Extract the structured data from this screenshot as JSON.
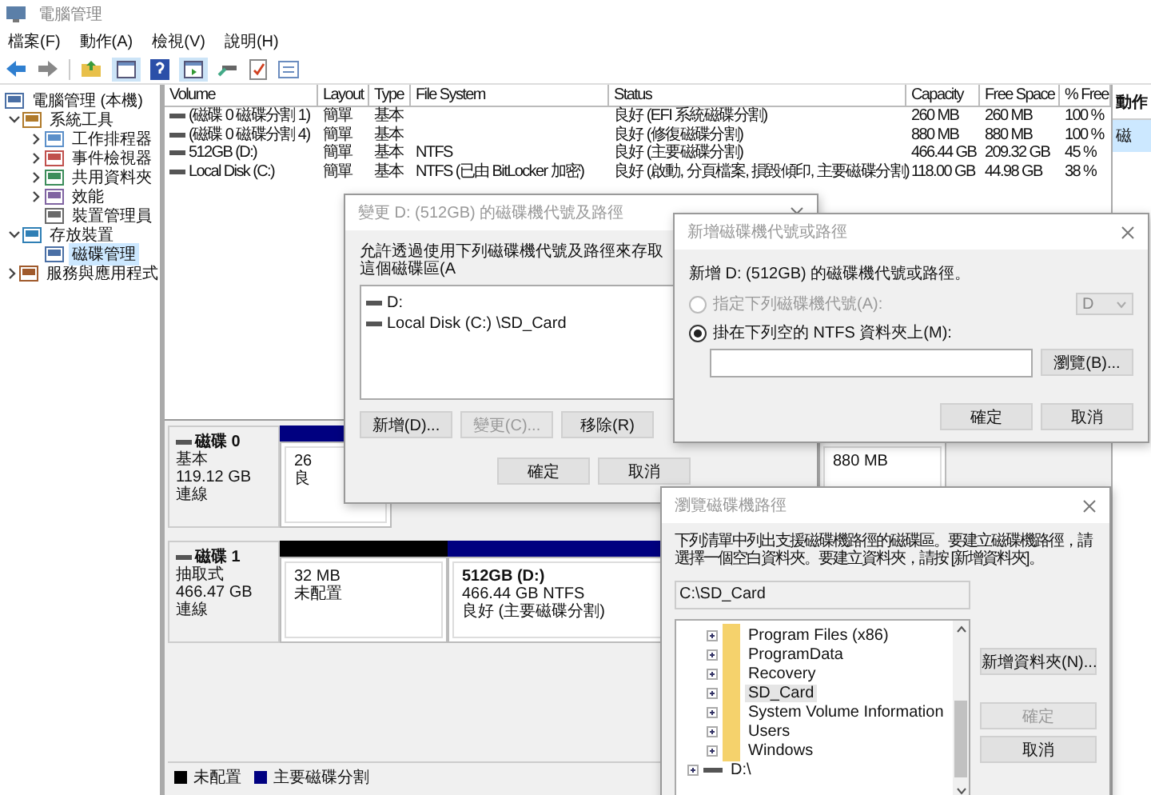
{
  "window": {
    "title": "電腦管理"
  },
  "menu": [
    "檔案(F)",
    "動作(A)",
    "檢視(V)",
    "說明(H)"
  ],
  "tree": [
    {
      "label": "電腦管理 (本機)",
      "kind": "root",
      "selected": false,
      "children": [
        {
          "label": "系統工具",
          "kind": "node",
          "expanded": true,
          "selected": false,
          "children": [
            {
              "label": "工作排程器",
              "kind": "node",
              "expanded": false,
              "selected": false
            },
            {
              "label": "事件檢視器",
              "kind": "node",
              "expanded": false,
              "selected": false
            },
            {
              "label": "共用資料夾",
              "kind": "node",
              "expanded": false,
              "selected": false
            },
            {
              "label": "效能",
              "kind": "node",
              "expanded": false,
              "selected": false
            },
            {
              "label": "裝置管理員",
              "kind": "leaf",
              "selected": false
            }
          ]
        },
        {
          "label": "存放裝置",
          "kind": "node",
          "expanded": true,
          "selected": false,
          "children": [
            {
              "label": "磁碟管理",
              "kind": "leaf",
              "selected": true
            }
          ]
        },
        {
          "label": "服務與應用程式",
          "kind": "node",
          "expanded": false,
          "selected": false
        }
      ]
    }
  ],
  "table": {
    "columns": [
      "Volume",
      "Layout",
      "Type",
      "File System",
      "Status",
      "Capacity",
      "Free Space",
      "% Free"
    ],
    "rows": [
      [
        "(磁碟 0 磁碟分割 1)",
        "簡單",
        "基本",
        "",
        "良好 (EFI 系統磁碟分割)",
        "260 MB",
        "260 MB",
        "100 %"
      ],
      [
        "(磁碟 0 磁碟分割 4)",
        "簡單",
        "基本",
        "",
        "良好 (修復磁碟分割)",
        "880 MB",
        "880 MB",
        "100 %"
      ],
      [
        "512GB (D:)",
        "簡單",
        "基本",
        "NTFS",
        "良好 (主要磁碟分割)",
        "466.44 GB",
        "209.32 GB",
        "45 %"
      ],
      [
        "Local Disk (C:)",
        "簡單",
        "基本",
        "NTFS (已由 BitLocker 加密)",
        "良好 (啟動, 分頁檔案, 損毀傾印, 主要磁碟分割)",
        "118.00 GB",
        "44.98 GB",
        "38 %"
      ]
    ]
  },
  "disks": [
    {
      "name": "磁碟 0",
      "type": "基本",
      "size": "119.12 GB",
      "status": "連線",
      "partitions": [
        {
          "lines": [
            "26",
            "良"
          ],
          "color": "#000080"
        },
        {
          "lines": [
            "880 MB"
          ]
        }
      ]
    },
    {
      "name": "磁碟 1",
      "type": "抽取式",
      "size": "466.47 GB",
      "status": "連線",
      "partitions": [
        {
          "lines": [
            "32 MB",
            "未配置"
          ],
          "color": "#000000"
        },
        {
          "title": "512GB  (D:)",
          "lines": [
            "466.44 GB NTFS",
            "良好 (主要磁碟分割)"
          ],
          "color": "#000080"
        }
      ]
    }
  ],
  "legend": [
    {
      "label": "未配置",
      "color": "#000000"
    },
    {
      "label": "主要磁碟分割",
      "color": "#000080"
    }
  ],
  "actions": {
    "title": "動作",
    "items": [
      {
        "label": "磁",
        "selected": true
      }
    ]
  },
  "change_dialog": {
    "title": "變更 D: (512GB) 的磁碟機代號及路徑",
    "text": "允許透過使用下列磁碟機代號及路徑來存取這個磁碟區(A",
    "paths": [
      "D:",
      "Local Disk (C:) \\SD_Card"
    ],
    "buttons": [
      {
        "label": "新增(D)...",
        "disabled": false
      },
      {
        "label": "變更(C)...",
        "disabled": true
      },
      {
        "label": "移除(R)",
        "disabled": false
      }
    ],
    "footer": [
      "確定",
      "取消"
    ]
  },
  "add_dialog": {
    "title": "新增磁碟機代號或路徑",
    "heading": "新增 D: (512GB) 的磁碟機代號或路徑。",
    "options": [
      {
        "label": "指定下列磁碟機代號(A):",
        "selected": false,
        "disabled": true
      },
      {
        "label": "掛在下列空的 NTFS 資料夾上(M):",
        "selected": true,
        "disabled": false
      }
    ],
    "letter": {
      "value": "D",
      "disabled": true
    },
    "browse": "瀏覽(B)...",
    "footer": [
      "確定",
      "取消"
    ]
  },
  "browse_dialog": {
    "title": "瀏覽磁碟機路徑",
    "text": "下列清單中列出支援磁碟機路徑的磁碟區。要建立磁碟機路徑，請選擇一個空白資料夾。要建立資料夾，請按 [新增資料夾]。",
    "path": "C:\\SD_Card",
    "rows": [
      {
        "label": "Program Files (x86)",
        "kind": "folder",
        "expanded": false,
        "selected": false
      },
      {
        "label": "ProgramData",
        "kind": "folder",
        "expanded": false,
        "selected": false
      },
      {
        "label": "Recovery",
        "kind": "folder",
        "expanded": false,
        "selected": false
      },
      {
        "label": "SD_Card",
        "kind": "folder",
        "expanded": false,
        "selected": true
      },
      {
        "label": "System Volume Information",
        "kind": "folder",
        "expanded": false,
        "selected": false
      },
      {
        "label": "Users",
        "kind": "folder",
        "expanded": false,
        "selected": false
      },
      {
        "label": "Windows",
        "kind": "folder",
        "expanded": false,
        "selected": false
      },
      {
        "label": "D:\\",
        "kind": "drive",
        "expanded": false,
        "selected": false
      }
    ],
    "buttons": [
      {
        "label": "新增資料夾(N)...",
        "disabled": false
      },
      {
        "label": "確定",
        "disabled": true
      },
      {
        "label": "取消",
        "disabled": false
      }
    ]
  }
}
